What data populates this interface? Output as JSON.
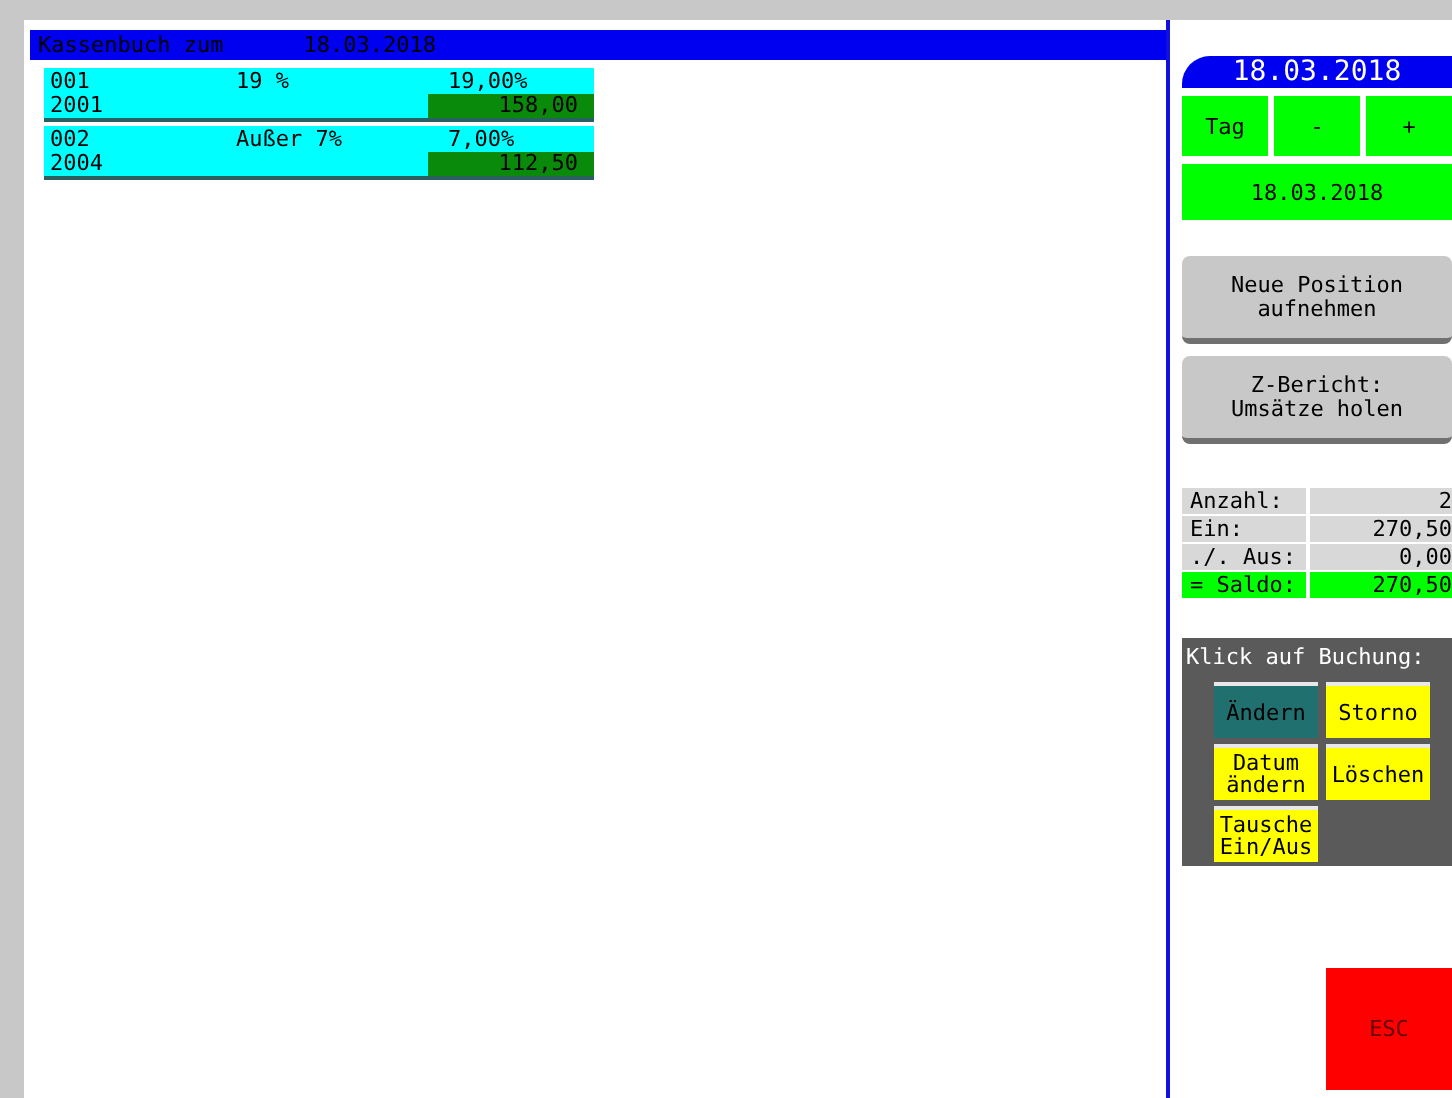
{
  "title_bar": {
    "label": "Kassenbuch zum",
    "date": "18.03.2018"
  },
  "bookings": [
    {
      "number": "001",
      "account": "2001",
      "tax_label": "19 %",
      "tax_rate": "19,00%",
      "amount": "158,00"
    },
    {
      "number": "002",
      "account": "2004",
      "tax_label": "Außer  7%",
      "tax_rate": "7,00%",
      "amount": "112,50"
    }
  ],
  "side": {
    "date_header": "18.03.2018",
    "step_buttons": [
      "Tag",
      "-",
      "+"
    ],
    "date_field": "18.03.2018",
    "actions": [
      "Neue Position aufnehmen",
      "Z-Bericht: Umsätze holen"
    ],
    "summary": [
      {
        "label": "Anzahl:",
        "value": "2",
        "highlight": false
      },
      {
        "label": "Ein:",
        "value": "270,50",
        "highlight": false
      },
      {
        "label": "./. Aus:",
        "value": "0,00",
        "highlight": false
      },
      {
        "label": "= Saldo:",
        "value": "270,50",
        "highlight": true
      }
    ],
    "booking_panel": {
      "title": "Klick auf Buchung:",
      "buttons": [
        {
          "label": "Ändern",
          "selected": true
        },
        {
          "label": "Storno",
          "selected": false
        },
        {
          "label": "Datum ändern",
          "selected": false
        },
        {
          "label": "Löschen",
          "selected": false
        },
        {
          "label": "Tausche Ein/Aus",
          "selected": false
        }
      ]
    },
    "esc": "ESC"
  }
}
